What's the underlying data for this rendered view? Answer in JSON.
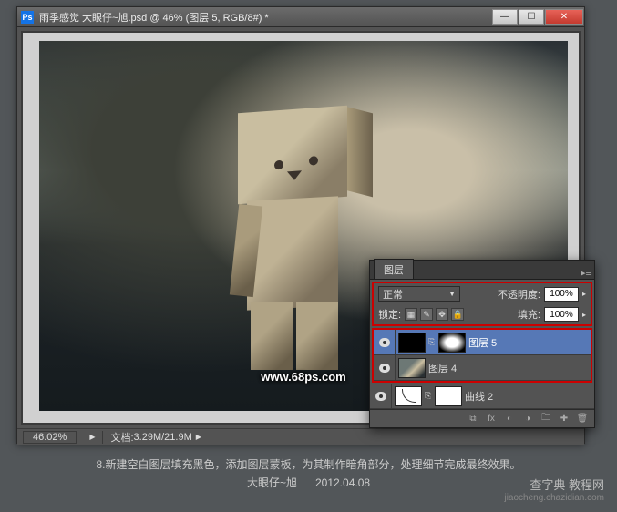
{
  "window": {
    "title": "雨季感觉  大眼仔~旭.psd @ 46% (图层 5, RGB/8#) *"
  },
  "watermark": "www.68ps.com",
  "statusbar": {
    "zoom": "46.02%",
    "doc_label": "文档:",
    "doc_value": "3.29M/21.9M"
  },
  "panel": {
    "tab": "图层",
    "blend_mode": "正常",
    "opacity_label": "不透明度:",
    "opacity_value": "100%",
    "lock_label": "锁定:",
    "fill_label": "填充:",
    "fill_value": "100%",
    "layers": [
      {
        "name": "图层 5",
        "selected": true
      },
      {
        "name": "图层 4",
        "selected": false
      },
      {
        "name": "曲线 2",
        "selected": false
      }
    ]
  },
  "caption": {
    "line1": "8.新建空白图层填充黑色，添加图层蒙板，为其制作暗角部分，处理细节完成最终效果。",
    "line2_author": "大眼仔~旭",
    "line2_date": "2012.04.08"
  },
  "brand": {
    "name": "查字典 教程网",
    "url": "jiaocheng.chazidian.com"
  }
}
